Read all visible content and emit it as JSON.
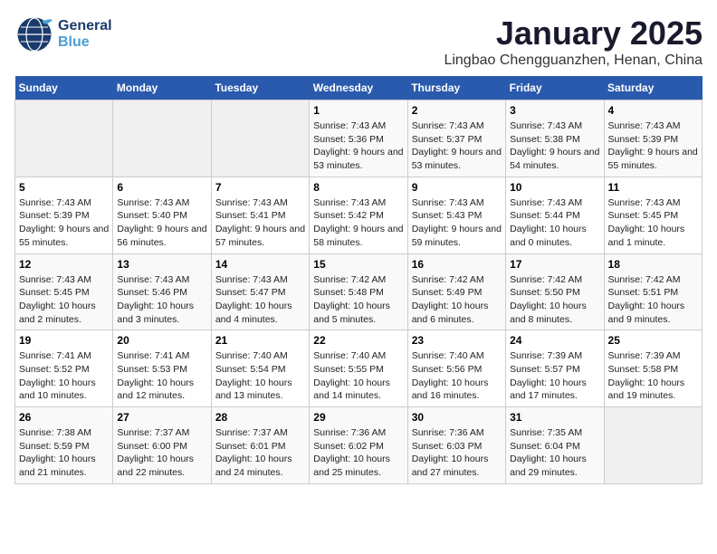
{
  "header": {
    "logo_general": "General",
    "logo_blue": "Blue",
    "title": "January 2025",
    "subtitle": "Lingbao Chengguanzhen, Henan, China"
  },
  "days_of_week": [
    "Sunday",
    "Monday",
    "Tuesday",
    "Wednesday",
    "Thursday",
    "Friday",
    "Saturday"
  ],
  "weeks": [
    {
      "days": [
        {
          "num": "",
          "empty": true
        },
        {
          "num": "",
          "empty": true
        },
        {
          "num": "",
          "empty": true
        },
        {
          "num": "1",
          "sunrise": "7:43 AM",
          "sunset": "5:36 PM",
          "daylight": "9 hours and 53 minutes."
        },
        {
          "num": "2",
          "sunrise": "7:43 AM",
          "sunset": "5:37 PM",
          "daylight": "9 hours and 53 minutes."
        },
        {
          "num": "3",
          "sunrise": "7:43 AM",
          "sunset": "5:38 PM",
          "daylight": "9 hours and 54 minutes."
        },
        {
          "num": "4",
          "sunrise": "7:43 AM",
          "sunset": "5:39 PM",
          "daylight": "9 hours and 55 minutes."
        }
      ]
    },
    {
      "days": [
        {
          "num": "5",
          "sunrise": "7:43 AM",
          "sunset": "5:39 PM",
          "daylight": "9 hours and 55 minutes."
        },
        {
          "num": "6",
          "sunrise": "7:43 AM",
          "sunset": "5:40 PM",
          "daylight": "9 hours and 56 minutes."
        },
        {
          "num": "7",
          "sunrise": "7:43 AM",
          "sunset": "5:41 PM",
          "daylight": "9 hours and 57 minutes."
        },
        {
          "num": "8",
          "sunrise": "7:43 AM",
          "sunset": "5:42 PM",
          "daylight": "9 hours and 58 minutes."
        },
        {
          "num": "9",
          "sunrise": "7:43 AM",
          "sunset": "5:43 PM",
          "daylight": "9 hours and 59 minutes."
        },
        {
          "num": "10",
          "sunrise": "7:43 AM",
          "sunset": "5:44 PM",
          "daylight": "10 hours and 0 minutes."
        },
        {
          "num": "11",
          "sunrise": "7:43 AM",
          "sunset": "5:45 PM",
          "daylight": "10 hours and 1 minute."
        }
      ]
    },
    {
      "days": [
        {
          "num": "12",
          "sunrise": "7:43 AM",
          "sunset": "5:45 PM",
          "daylight": "10 hours and 2 minutes."
        },
        {
          "num": "13",
          "sunrise": "7:43 AM",
          "sunset": "5:46 PM",
          "daylight": "10 hours and 3 minutes."
        },
        {
          "num": "14",
          "sunrise": "7:43 AM",
          "sunset": "5:47 PM",
          "daylight": "10 hours and 4 minutes."
        },
        {
          "num": "15",
          "sunrise": "7:42 AM",
          "sunset": "5:48 PM",
          "daylight": "10 hours and 5 minutes."
        },
        {
          "num": "16",
          "sunrise": "7:42 AM",
          "sunset": "5:49 PM",
          "daylight": "10 hours and 6 minutes."
        },
        {
          "num": "17",
          "sunrise": "7:42 AM",
          "sunset": "5:50 PM",
          "daylight": "10 hours and 8 minutes."
        },
        {
          "num": "18",
          "sunrise": "7:42 AM",
          "sunset": "5:51 PM",
          "daylight": "10 hours and 9 minutes."
        }
      ]
    },
    {
      "days": [
        {
          "num": "19",
          "sunrise": "7:41 AM",
          "sunset": "5:52 PM",
          "daylight": "10 hours and 10 minutes."
        },
        {
          "num": "20",
          "sunrise": "7:41 AM",
          "sunset": "5:53 PM",
          "daylight": "10 hours and 12 minutes."
        },
        {
          "num": "21",
          "sunrise": "7:40 AM",
          "sunset": "5:54 PM",
          "daylight": "10 hours and 13 minutes."
        },
        {
          "num": "22",
          "sunrise": "7:40 AM",
          "sunset": "5:55 PM",
          "daylight": "10 hours and 14 minutes."
        },
        {
          "num": "23",
          "sunrise": "7:40 AM",
          "sunset": "5:56 PM",
          "daylight": "10 hours and 16 minutes."
        },
        {
          "num": "24",
          "sunrise": "7:39 AM",
          "sunset": "5:57 PM",
          "daylight": "10 hours and 17 minutes."
        },
        {
          "num": "25",
          "sunrise": "7:39 AM",
          "sunset": "5:58 PM",
          "daylight": "10 hours and 19 minutes."
        }
      ]
    },
    {
      "days": [
        {
          "num": "26",
          "sunrise": "7:38 AM",
          "sunset": "5:59 PM",
          "daylight": "10 hours and 21 minutes."
        },
        {
          "num": "27",
          "sunrise": "7:37 AM",
          "sunset": "6:00 PM",
          "daylight": "10 hours and 22 minutes."
        },
        {
          "num": "28",
          "sunrise": "7:37 AM",
          "sunset": "6:01 PM",
          "daylight": "10 hours and 24 minutes."
        },
        {
          "num": "29",
          "sunrise": "7:36 AM",
          "sunset": "6:02 PM",
          "daylight": "10 hours and 25 minutes."
        },
        {
          "num": "30",
          "sunrise": "7:36 AM",
          "sunset": "6:03 PM",
          "daylight": "10 hours and 27 minutes."
        },
        {
          "num": "31",
          "sunrise": "7:35 AM",
          "sunset": "6:04 PM",
          "daylight": "10 hours and 29 minutes."
        },
        {
          "num": "",
          "empty": true
        }
      ]
    }
  ]
}
